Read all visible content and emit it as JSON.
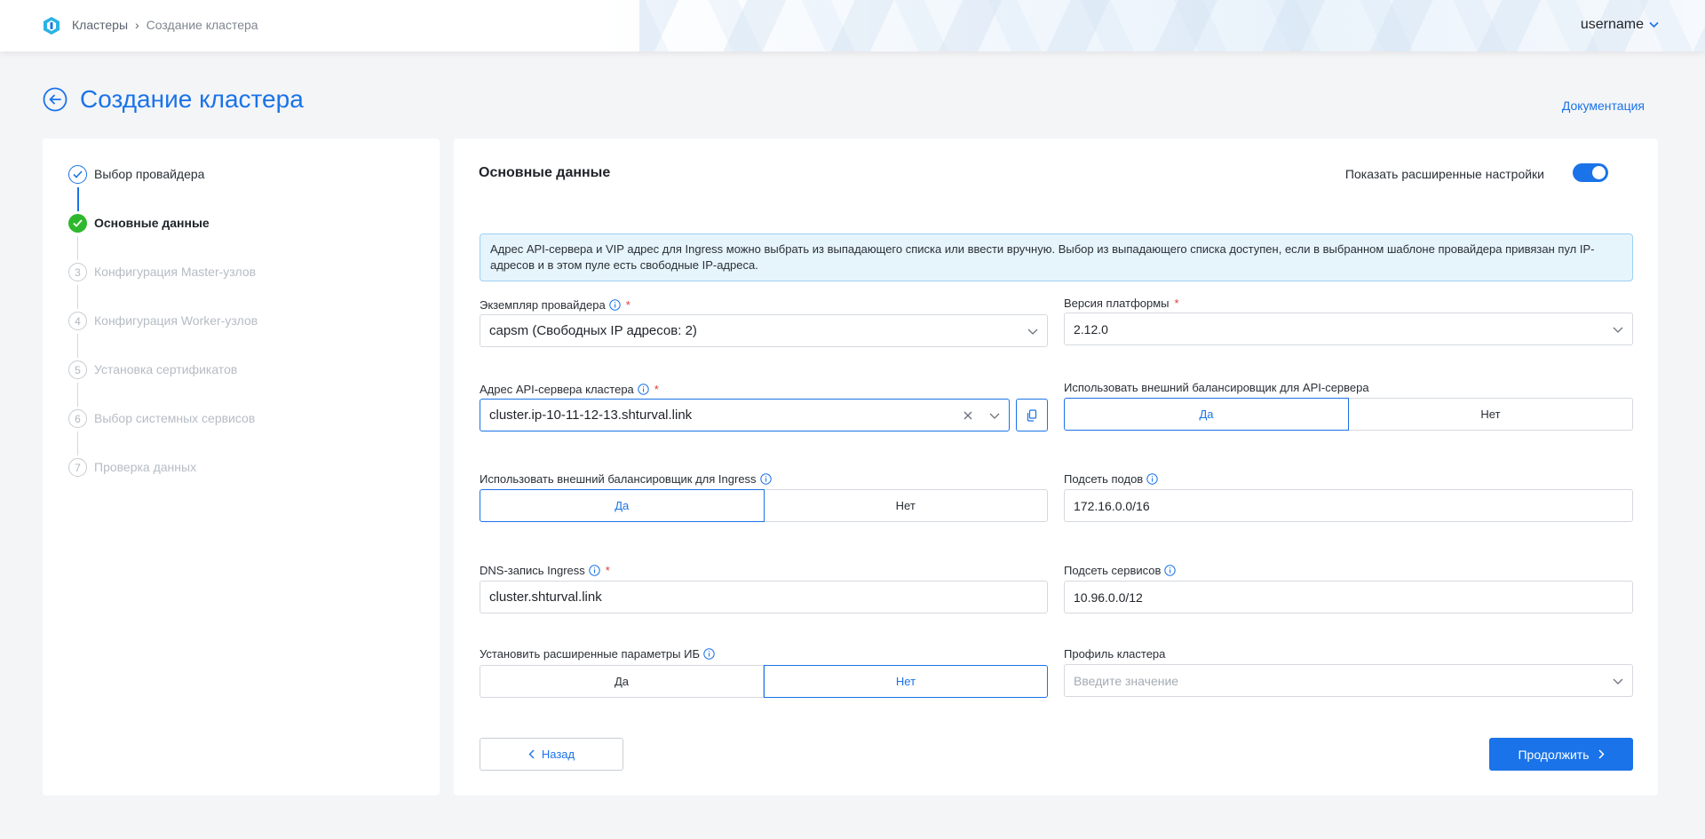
{
  "header": {
    "breadcrumbs": [
      "Кластеры",
      "Создание кластера"
    ],
    "breadcrumb_separator": "›",
    "username": "username"
  },
  "page": {
    "title": "Создание кластера",
    "doc_link": "Документация"
  },
  "stepper": {
    "steps": [
      {
        "number": "1",
        "label": "Выбор провайдера",
        "state": "done"
      },
      {
        "number": "2",
        "label": "Основные данные",
        "state": "active"
      },
      {
        "number": "3",
        "label": "Конфигурация Master-узлов",
        "state": "pending"
      },
      {
        "number": "4",
        "label": "Конфигурация Worker-узлов",
        "state": "pending"
      },
      {
        "number": "5",
        "label": "Установка сертификатов",
        "state": "pending"
      },
      {
        "number": "6",
        "label": "Выбор системных сервисов",
        "state": "pending"
      },
      {
        "number": "7",
        "label": "Проверка данных",
        "state": "pending"
      }
    ]
  },
  "form": {
    "section_title": "Основные данные",
    "advanced_toggle_label": "Показать расширенные настройки",
    "advanced_toggle_on": true,
    "info_text": "Адрес API-сервера и VIP адрес для Ingress можно выбрать из выпадающего списка или ввести вручную. Выбор из выпадающего списка доступен, если в выбранном шаблоне провайдера привязан пул IP-адресов и в этом пуле есть свободные IP-адреса.",
    "provider_instance": {
      "label": "Экземпляр провайдера",
      "required": "*",
      "value": "capsm (Свободных IP адресов: 2)"
    },
    "platform_version": {
      "label": "Версия платформы",
      "required": "*",
      "value": "2.12.0"
    },
    "api_server_address": {
      "label": "Адрес API-сервера кластера",
      "required": "*",
      "value": "cluster.ip-10-11-12-13.shturval.link"
    },
    "external_lb_api": {
      "label": "Использовать внешний балансировщик для API-сервера",
      "options": [
        "Да",
        "Нет"
      ],
      "selected": "Да"
    },
    "external_lb_ingress": {
      "label": "Использовать внешний балансировщик для Ingress",
      "options": [
        "Да",
        "Нет"
      ],
      "selected": "Да"
    },
    "pod_subnet": {
      "label": "Подсеть подов",
      "value": "172.16.0.0/16"
    },
    "dns_ingress": {
      "label": "DNS-запись Ingress",
      "required": "*",
      "value": "cluster.shturval.link"
    },
    "service_subnet": {
      "label": "Подсеть сервисов",
      "value": "10.96.0.0/12"
    },
    "security_params": {
      "label": "Установить расширенные параметры ИБ",
      "options": [
        "Да",
        "Нет"
      ],
      "selected": "Нет"
    },
    "cluster_profile": {
      "label": "Профиль кластера",
      "placeholder": "Введите значение"
    },
    "back_label": "Назад",
    "next_label": "Продолжить"
  },
  "colors": {
    "accent": "#1a73e8",
    "success": "#2eb82e",
    "required": "#e53935",
    "info_bg": "#e6f4fc"
  }
}
